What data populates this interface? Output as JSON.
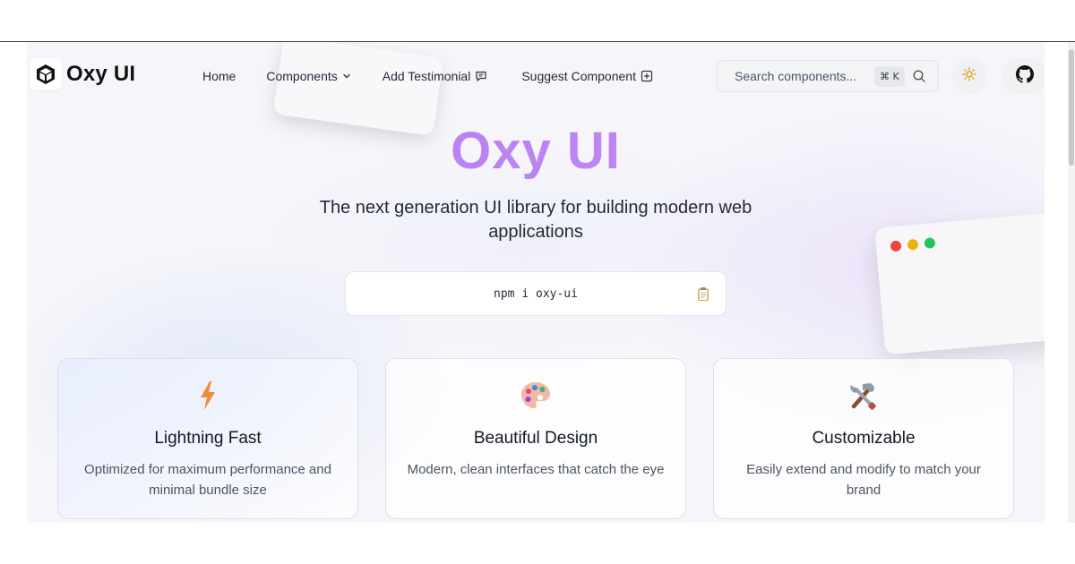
{
  "brand": {
    "name": "Oxy UI",
    "accent": "#b07bf1"
  },
  "nav": {
    "home": "Home",
    "components": "Components",
    "add_testimonial": "Add Testimonial",
    "suggest_component": "Suggest Component"
  },
  "search": {
    "placeholder": "Search components...",
    "shortcut": "⌘ K"
  },
  "hero": {
    "title": "Oxy UI",
    "subtitle": "The next generation UI library for building modern web applications",
    "install_command": "npm i oxy-ui"
  },
  "features": [
    {
      "icon": "lightning-icon",
      "title": "Lightning Fast",
      "description": "Optimized for maximum performance and minimal bundle size"
    },
    {
      "icon": "palette-icon",
      "title": "Beautiful Design",
      "description": "Modern, clean interfaces that catch the eye"
    },
    {
      "icon": "tools-icon",
      "title": "Customizable",
      "description": "Easily extend and modify to match your brand"
    }
  ]
}
